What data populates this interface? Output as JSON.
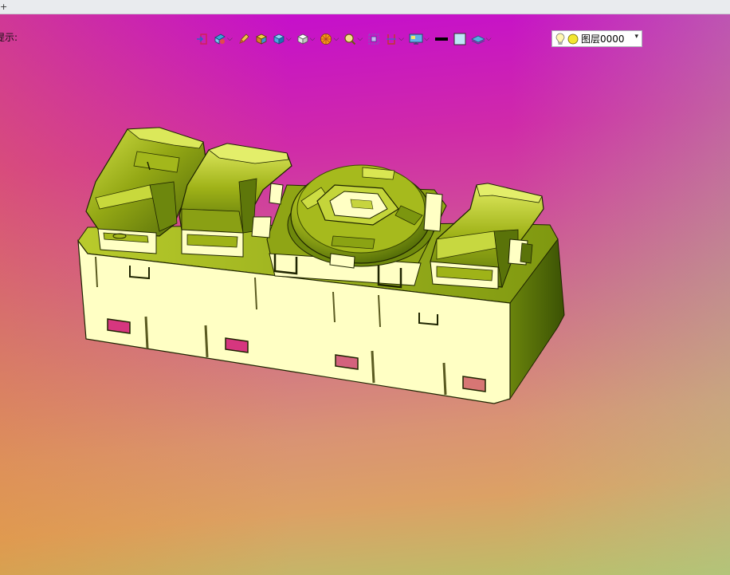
{
  "window": {
    "corner_glyph": "+"
  },
  "viewport": {
    "prompt_text": "提示:",
    "gradient": {
      "top": "#c30ad2",
      "middle": "#cf6a8c",
      "bottom_left": "#e39a3a",
      "bottom_right": "#b7c26a"
    }
  },
  "toolbar": {
    "buttons": [
      {
        "name": "exit-sketch-icon",
        "has_menu": false
      },
      {
        "name": "view-orient-icon",
        "has_menu": true
      },
      {
        "name": "pencil-icon",
        "has_menu": false
      },
      {
        "name": "shaded-solid-icon",
        "has_menu": false
      },
      {
        "name": "cube-blue-icon",
        "has_menu": true
      },
      {
        "name": "cube-white-icon",
        "has_menu": true
      },
      {
        "name": "render-sphere-icon",
        "has_menu": true
      },
      {
        "name": "zoom-icon",
        "has_menu": true
      },
      {
        "name": "zoom-fit-icon",
        "has_menu": false
      },
      {
        "name": "section-view-icon",
        "has_menu": true
      },
      {
        "name": "display-monitor-icon",
        "has_menu": true
      },
      {
        "name": "line-color-icon",
        "has_menu": false
      },
      {
        "name": "face-color-icon",
        "has_menu": false
      },
      {
        "name": "layer-plane-icon",
        "has_menu": true
      }
    ],
    "layer_selector": {
      "label": "图层0000",
      "bulb_icon": "lightbulb-icon",
      "color_icon": "layer-color-dot-icon",
      "dropdown_icon": "dropdown-arrow-icon"
    }
  },
  "model": {
    "description_name": "switch-housing-3d-model",
    "colors": {
      "body_face": "#ffffc4",
      "body_shadow": "#4f6a08",
      "cap_green": "#94a815",
      "cap_highlight": "#d9e54b",
      "cap_dark": "#485f06",
      "outline": "#1e2400"
    }
  }
}
